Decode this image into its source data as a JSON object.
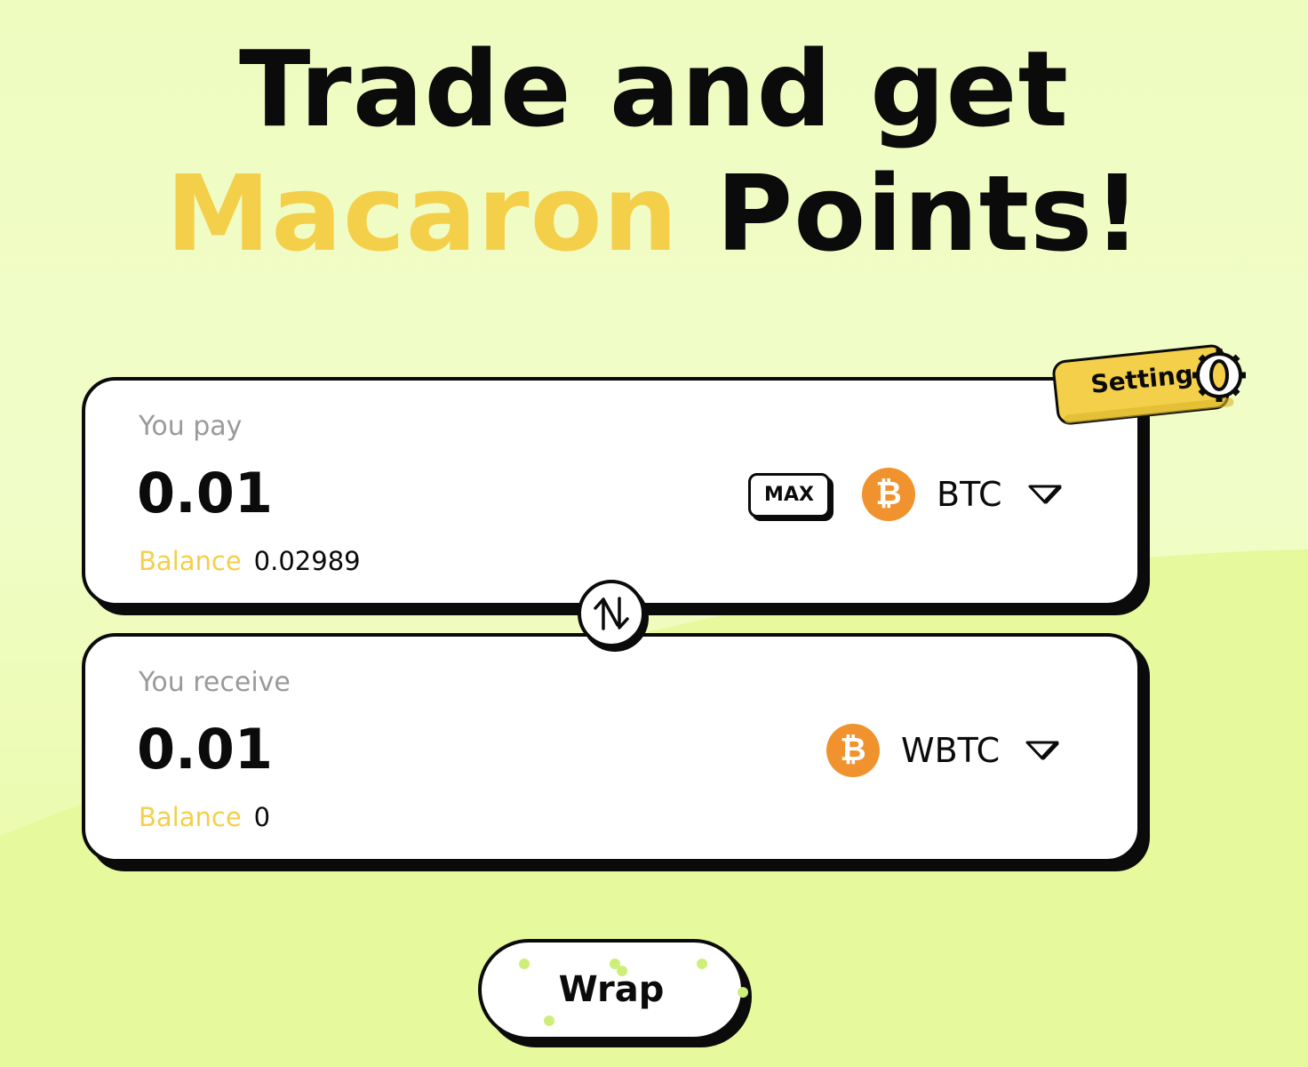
{
  "headline": {
    "line1": "Trade and get",
    "accent": "Macaron",
    "rest": " Points!"
  },
  "colors": {
    "accent": "#f4cf4a",
    "ink": "#0b0b0b",
    "bitcoin": "#f0932e",
    "background": "#eefcc0"
  },
  "setting": {
    "label": "Setting",
    "icon": "gear-icon"
  },
  "pay": {
    "label": "You pay",
    "amount": "0.01",
    "max_label": "MAX",
    "token": {
      "name": "BTC",
      "icon": "bitcoin-icon",
      "symbol": "₿"
    },
    "balance_label": "Balance",
    "balance_value": "0.02989"
  },
  "swap": {
    "icon": "swap-arrows-icon"
  },
  "receive": {
    "label": "You receive",
    "amount": "0.01",
    "token": {
      "name": "WBTC",
      "icon": "bitcoin-icon",
      "symbol": "₿"
    },
    "balance_label": "Balance",
    "balance_value": "0"
  },
  "action": {
    "label": "Wrap"
  }
}
